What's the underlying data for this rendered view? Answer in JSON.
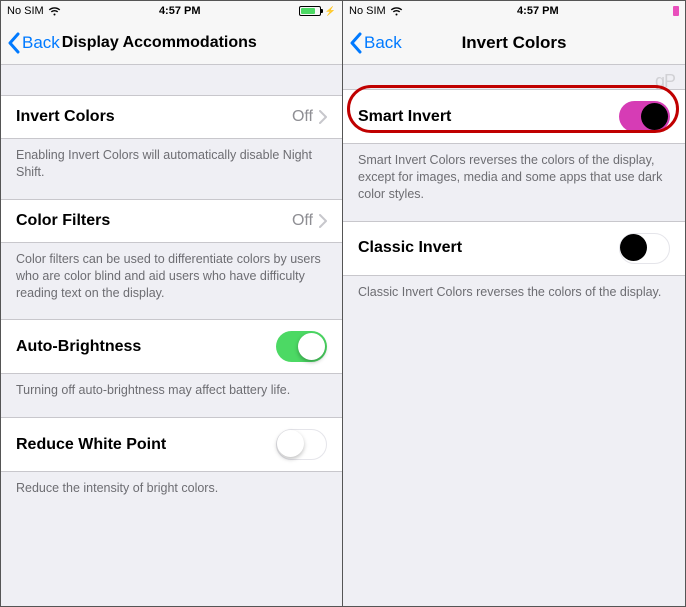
{
  "left": {
    "status": {
      "carrier": "No SIM",
      "time": "4:57 PM"
    },
    "nav": {
      "back": "Back",
      "title": "Display Accommodations"
    },
    "invertColors": {
      "label": "Invert Colors",
      "value": "Off",
      "footer": "Enabling Invert Colors will automatically disable Night Shift."
    },
    "colorFilters": {
      "label": "Color Filters",
      "value": "Off",
      "footer": "Color filters can be used to differentiate colors by users who are color blind and aid users who have difficulty reading text on the display."
    },
    "autoBrightness": {
      "label": "Auto-Brightness",
      "footer": "Turning off auto-brightness may affect battery life."
    },
    "reduceWhitePoint": {
      "label": "Reduce White Point",
      "footer": "Reduce the intensity of bright colors."
    }
  },
  "right": {
    "status": {
      "carrier": "No SIM",
      "time": "4:57 PM"
    },
    "nav": {
      "back": "Back",
      "title": "Invert Colors"
    },
    "smartInvert": {
      "label": "Smart Invert",
      "footer": "Smart Invert Colors reverses the colors of the display, except for images, media and some apps that use dark color styles."
    },
    "classicInvert": {
      "label": "Classic Invert",
      "footer": "Classic Invert Colors reverses the colors of the display."
    },
    "watermark": "gP"
  }
}
